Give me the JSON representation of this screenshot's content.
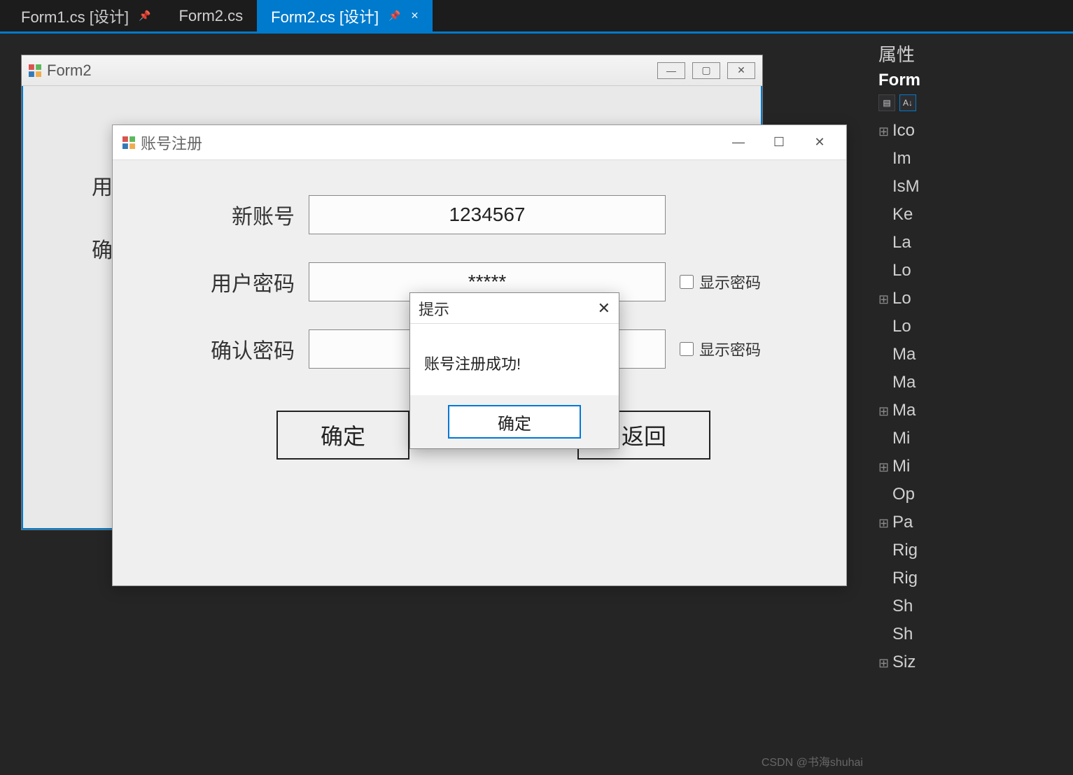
{
  "tabs": [
    {
      "label": "Form1.cs [设计]",
      "pinned": true,
      "active": false,
      "closeable": false
    },
    {
      "label": "Form2.cs",
      "pinned": false,
      "active": false,
      "closeable": false
    },
    {
      "label": "Form2.cs [设计]",
      "pinned": true,
      "active": true,
      "closeable": true
    }
  ],
  "form2": {
    "title": "Form2",
    "peek_labels": {
      "l1": "用",
      "l2": "确"
    }
  },
  "reg_dialog": {
    "title": "账号注册",
    "fields": {
      "new_account": {
        "label": "新账号",
        "value": "1234567"
      },
      "password": {
        "label": "用户密码",
        "value": "*****",
        "show_label": "显示密码",
        "checked": false
      },
      "confirm": {
        "label": "确认密码",
        "value": "",
        "show_label": "显示密码",
        "checked": false
      }
    },
    "buttons": {
      "ok": "确定",
      "back": "返回"
    },
    "window_controls": {
      "minimize": "—",
      "maximize": "☐",
      "close": "✕"
    }
  },
  "msgbox": {
    "title": "提示",
    "message": "账号注册成功!",
    "ok": "确定",
    "close": "✕"
  },
  "properties_panel": {
    "title": "属性",
    "object": "Form",
    "items": [
      {
        "expand": true,
        "label": "Ico"
      },
      {
        "expand": false,
        "label": "Im"
      },
      {
        "expand": false,
        "label": "IsM"
      },
      {
        "expand": false,
        "label": "Ke"
      },
      {
        "expand": false,
        "label": "La"
      },
      {
        "expand": false,
        "label": "Lo"
      },
      {
        "expand": true,
        "label": "Lo"
      },
      {
        "expand": false,
        "label": "Lo"
      },
      {
        "expand": false,
        "label": "Ma"
      },
      {
        "expand": false,
        "label": "Ma"
      },
      {
        "expand": true,
        "label": "Ma"
      },
      {
        "expand": false,
        "label": "Mi"
      },
      {
        "expand": true,
        "label": "Mi"
      },
      {
        "expand": false,
        "label": "Op"
      },
      {
        "expand": true,
        "label": "Pa"
      },
      {
        "expand": false,
        "label": "Rig"
      },
      {
        "expand": false,
        "label": "Rig"
      },
      {
        "expand": false,
        "label": "Sh"
      },
      {
        "expand": false,
        "label": "Sh"
      },
      {
        "expand": true,
        "label": "Siz"
      }
    ]
  },
  "watermark": "CSDN @书海shuhai"
}
